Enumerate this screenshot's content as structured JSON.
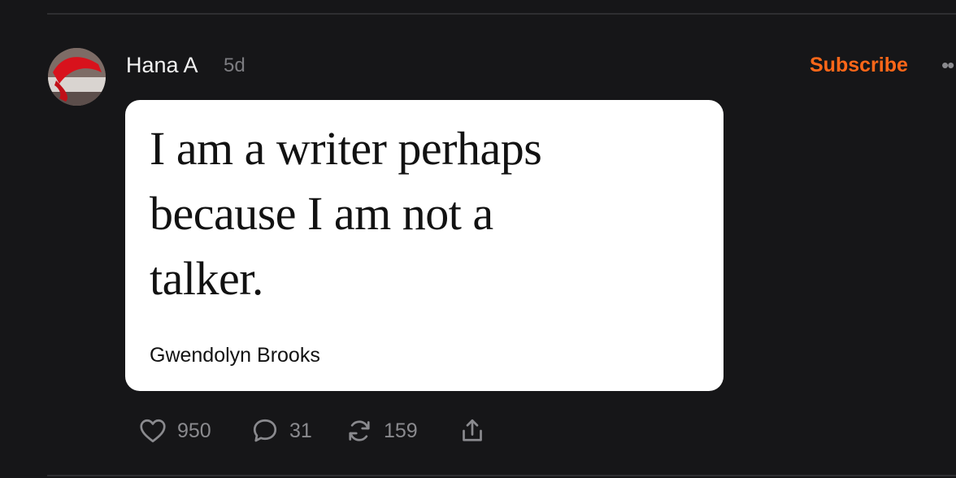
{
  "post": {
    "author": "Hana A",
    "time": "5d",
    "subscribe_label": "Subscribe",
    "more_icon": "ellipsis-icon"
  },
  "quote": {
    "lines": [
      "I am a writer perhaps",
      "because I am not a",
      "talker."
    ],
    "author": "Gwendolyn Brooks",
    "background": "#ffffff"
  },
  "actions": {
    "likes": "950",
    "comments": "31",
    "restacks": "159"
  },
  "colors": {
    "background": "#161618",
    "accent": "#ff6719",
    "muted": "#8a8a8e"
  }
}
